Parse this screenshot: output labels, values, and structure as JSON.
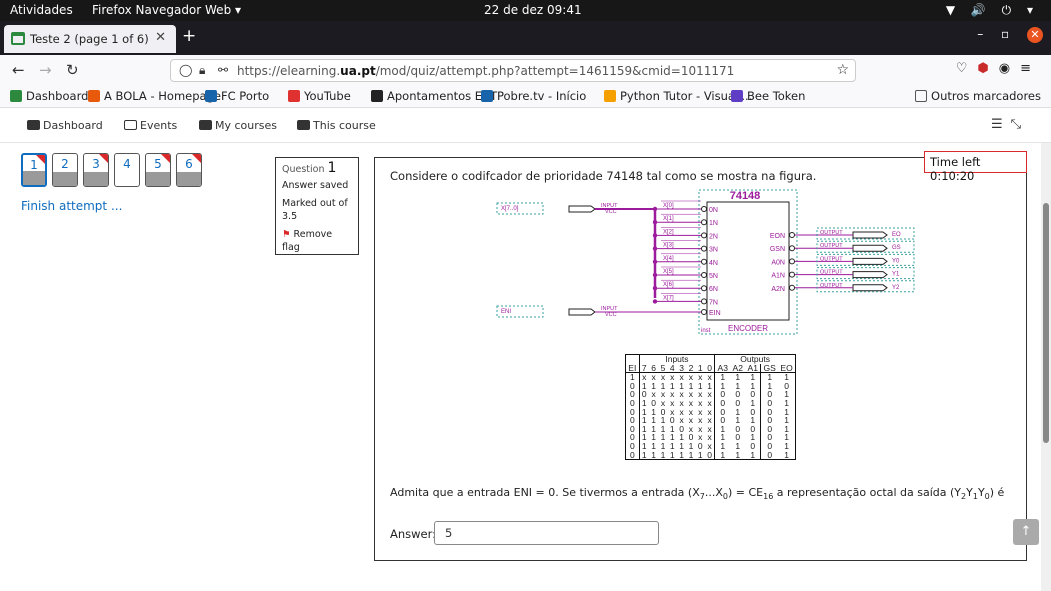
{
  "os": {
    "activities": "Atividades",
    "app": "Firefox Navegador Web ▾",
    "clock": "22 de dez  09:41",
    "tray": "▼ 🔊 ⏻ ▾"
  },
  "browser": {
    "tab_title": "Teste 2 (page 1 of 6)",
    "url_prefix": "https://elearning.",
    "url_domain": "ua.pt",
    "url_suffix": "/mod/quiz/attempt.php?attempt=1461159&cmid=1011171",
    "bookmarks": [
      {
        "label": "Dashboard",
        "color": "#2b8a3e"
      },
      {
        "label": "A BOLA - Homepage",
        "color": "#e8590c"
      },
      {
        "label": "FC Porto",
        "color": "#1864ab"
      },
      {
        "label": "YouTube",
        "color": "#e03131"
      },
      {
        "label": "Apontamentos ECT",
        "color": "#222222"
      },
      {
        "label": "Pobre.tv - Início",
        "color": "#1864ab"
      },
      {
        "label": "Python Tutor - Visuali...",
        "color": "#f59f00"
      },
      {
        "label": "Bee Token",
        "color": "#5f3dc4"
      }
    ],
    "other_bookmarks": "Outros marcadores"
  },
  "moodle_nav": [
    {
      "label": "Dashboard",
      "icon": "tachometer-icon"
    },
    {
      "label": "Events",
      "icon": "calendar-icon"
    },
    {
      "label": "My courses",
      "icon": "briefcase-icon"
    },
    {
      "label": "This course",
      "icon": "sitemap-icon"
    }
  ],
  "quiz_nav": {
    "questions": [
      {
        "n": "1",
        "current": true,
        "flagged": true
      },
      {
        "n": "2",
        "current": false,
        "flagged": false
      },
      {
        "n": "3",
        "current": false,
        "flagged": true
      },
      {
        "n": "4",
        "current": false,
        "flagged": false,
        "answered": false
      },
      {
        "n": "5",
        "current": false,
        "flagged": true
      },
      {
        "n": "6",
        "current": false,
        "flagged": true
      }
    ],
    "finish": "Finish attempt ..."
  },
  "question_info": {
    "prefix": "Question",
    "number": "1",
    "status": "Answer saved",
    "marked": "Marked out of 3.5",
    "remove_flag": "Remove flag"
  },
  "timer": "Time left 0:10:20",
  "question": {
    "text": "Considere o codifcador de prioridade 74148 tal como se mostra na figura.",
    "admit_a": "Admita que a entrada ENI = 0. Se tivermos a entrada (X",
    "sub7": "7",
    "admit_b": "...X",
    "sub0": "0",
    "admit_c": ") = CE",
    "sub16": "16",
    "admit_d": " a representação octal da saída (Y",
    "sub2": "2",
    "y1": "Y",
    "sub1": "1",
    "y0": "Y",
    "subz": "0",
    "admit_e": ") é",
    "answer_label": "Answer:",
    "answer_value": "5"
  },
  "diagram": {
    "chip": "74148",
    "chip_footer": "ENCODER",
    "inst": "inst",
    "bus_label": "X[7..0]",
    "eni_label": "ENI",
    "input": "INPUT",
    "vcc": "VCC",
    "output": "OUTPUT",
    "in_pins": [
      "0N",
      "1N",
      "2N",
      "3N",
      "4N",
      "5N",
      "6N",
      "7N",
      "EIN"
    ],
    "x_labels": [
      "X[0]",
      "X[1]",
      "X[2]",
      "X[3]",
      "X[4]",
      "X[5]",
      "X[6]",
      "X[7]"
    ],
    "out_pins": [
      "EON",
      "GSN",
      "A0N",
      "A1N",
      "A2N"
    ],
    "out_labels": [
      "EO",
      "GS",
      "Y0",
      "Y1",
      "Y2"
    ]
  },
  "truth_table": {
    "group_inputs": "Inputs",
    "group_outputs": "Outputs",
    "headers": [
      "EI",
      "7",
      "6",
      "5",
      "4",
      "3",
      "2",
      "1",
      "0",
      "A3",
      "A2",
      "A1",
      "GS",
      "EO"
    ],
    "rows": [
      [
        "1",
        "x",
        "x",
        "x",
        "x",
        "x",
        "x",
        "x",
        "x",
        "1",
        "1",
        "1",
        "1",
        "1"
      ],
      [
        "0",
        "1",
        "1",
        "1",
        "1",
        "1",
        "1",
        "1",
        "1",
        "1",
        "1",
        "1",
        "1",
        "0"
      ],
      [
        "0",
        "0",
        "x",
        "x",
        "x",
        "x",
        "x",
        "x",
        "x",
        "0",
        "0",
        "0",
        "0",
        "1"
      ],
      [
        "0",
        "1",
        "0",
        "x",
        "x",
        "x",
        "x",
        "x",
        "x",
        "0",
        "0",
        "1",
        "0",
        "1"
      ],
      [
        "0",
        "1",
        "1",
        "0",
        "x",
        "x",
        "x",
        "x",
        "x",
        "0",
        "1",
        "0",
        "0",
        "1"
      ],
      [
        "0",
        "1",
        "1",
        "1",
        "0",
        "x",
        "x",
        "x",
        "x",
        "0",
        "1",
        "1",
        "0",
        "1"
      ],
      [
        "0",
        "1",
        "1",
        "1",
        "1",
        "0",
        "x",
        "x",
        "x",
        "1",
        "0",
        "0",
        "0",
        "1"
      ],
      [
        "0",
        "1",
        "1",
        "1",
        "1",
        "1",
        "0",
        "x",
        "x",
        "1",
        "0",
        "1",
        "0",
        "1"
      ],
      [
        "0",
        "1",
        "1",
        "1",
        "1",
        "1",
        "1",
        "0",
        "x",
        "1",
        "1",
        "0",
        "0",
        "1"
      ],
      [
        "0",
        "1",
        "1",
        "1",
        "1",
        "1",
        "1",
        "1",
        "0",
        "1",
        "1",
        "1",
        "0",
        "1"
      ]
    ]
  },
  "colors": {
    "accent": "#0f6cbf",
    "flag": "#d9292b",
    "wire": "#9c1a9c"
  }
}
